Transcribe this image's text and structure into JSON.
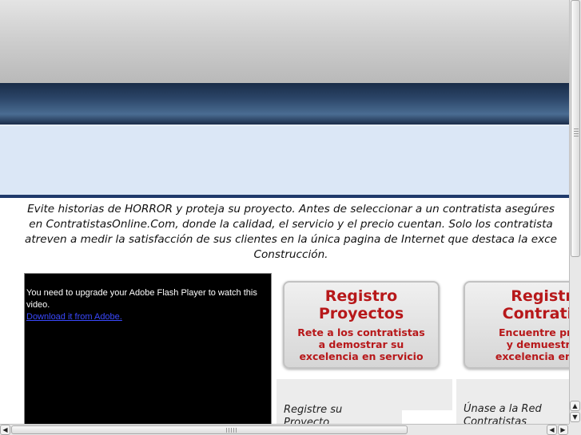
{
  "intro": {
    "text": "Evite historias de HORROR y proteja su proyecto. Antes de seleccionar a un contratista asegúres\nen ContratistasOnline.Com, donde la calidad, el servicio y el precio cuentan.  Solo los contratista\natreven a medir la satisfacción de sus clientes en la única pagina de Internet que destaca la exce\nConstrucción."
  },
  "flash": {
    "message": "You need to upgrade your Adobe Flash Player to watch this video.",
    "link": "Download it from Adobe."
  },
  "promos": [
    {
      "title_line1": "Registro",
      "title_line2": "Proyectos",
      "sub_line1": "Rete a los  contratistas",
      "sub_line2": "a demostrar su",
      "sub_line3": "excelencia en servicio"
    },
    {
      "title_line1": "Registr",
      "title_line2": "Contratis",
      "sub_line1": "Encuentre proy",
      "sub_line2": "y demuestre",
      "sub_line3": "excelencia en se"
    }
  ],
  "panels": [
    {
      "title": "Registre su\nProyecto"
    },
    {
      "title": "Únase a la Red\nContratistas"
    }
  ],
  "colors": {
    "navy": "#1f3a6b",
    "promo_red": "#b7181a",
    "link_blue": "#3a49ff"
  }
}
